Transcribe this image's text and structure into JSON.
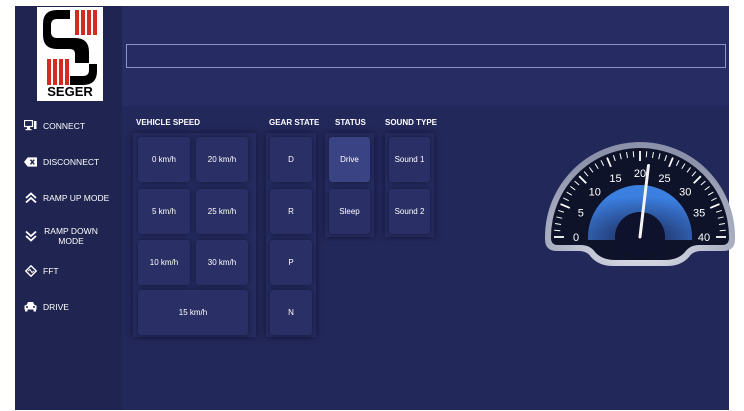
{
  "brand": {
    "logo_text": "SEGER"
  },
  "top_bar": {
    "value": ""
  },
  "sidebar": {
    "items": [
      {
        "label": "CONNECT",
        "icon": "monitor-plug-icon"
      },
      {
        "label": "DISCONNECT",
        "icon": "disconnect-x-icon"
      },
      {
        "label": "RAMP UP MODE",
        "icon": "double-chevron-up-icon"
      },
      {
        "label": "RAMP DOWN MODE",
        "icon": "double-chevron-down-icon"
      },
      {
        "label": "FFT",
        "icon": "fft-diamond-icon"
      },
      {
        "label": "DRIVE",
        "icon": "car-icon"
      }
    ]
  },
  "vehicle_speed": {
    "title": "VEHICLE SPEED",
    "buttons": [
      "0 km/h",
      "20 km/h",
      "5 km/h",
      "25 km/h",
      "10 km/h",
      "30 km/h",
      "15 km/h"
    ]
  },
  "gear_state": {
    "title": "GEAR STATE",
    "buttons": [
      "D",
      "R",
      "P",
      "N"
    ]
  },
  "status": {
    "title": "STATUS",
    "buttons": [
      "Drive",
      "Sleep"
    ],
    "selected": "Drive"
  },
  "sound_type": {
    "title": "SOUND TYPE",
    "buttons": [
      "Sound 1",
      "Sound 2"
    ]
  },
  "gauge": {
    "labels": [
      "0",
      "5",
      "10",
      "15",
      "20",
      "25",
      "30",
      "35",
      "40"
    ],
    "min": 0,
    "max": 40,
    "value": 21.5,
    "accent": "#2f6fc9",
    "face": "#0f1329",
    "bezel": "#b3b8cc"
  }
}
